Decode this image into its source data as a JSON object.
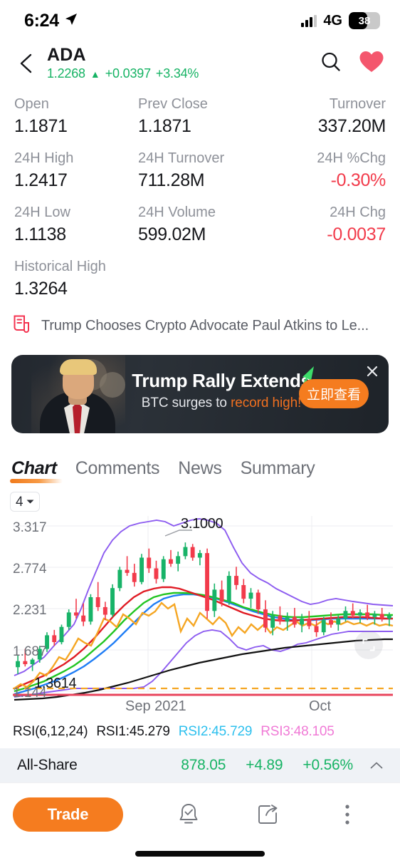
{
  "status_bar": {
    "time": "6:24",
    "location_icon": "location-arrow-icon",
    "signal_icon": "signal-bars-icon",
    "network": "4G",
    "battery_percent": "38"
  },
  "header": {
    "back_icon": "chevron-left-icon",
    "symbol": "ADA",
    "price": "1.2268",
    "direction_arrow": "▲",
    "change_abs": "+0.0397",
    "change_pct": "+3.34%",
    "up_color": "#16b364",
    "search_icon": "search-icon",
    "favorite_icon": "heart-icon",
    "favorite_color": "#f4566d"
  },
  "stats": {
    "rows": [
      [
        {
          "label": "Open",
          "value": "1.1871",
          "tone": "normal"
        },
        {
          "label": "Prev Close",
          "value": "1.1871",
          "tone": "normal"
        },
        {
          "label": "Turnover",
          "value": "337.20M",
          "tone": "normal"
        }
      ],
      [
        {
          "label": "24H High",
          "value": "1.2417",
          "tone": "normal"
        },
        {
          "label": "24H Turnover",
          "value": "711.28M",
          "tone": "normal"
        },
        {
          "label": "24H %Chg",
          "value": "-0.30%",
          "tone": "neg"
        }
      ],
      [
        {
          "label": "24H Low",
          "value": "1.1138",
          "tone": "normal"
        },
        {
          "label": "24H Volume",
          "value": "599.02M",
          "tone": "normal"
        },
        {
          "label": "24H Chg",
          "value": "-0.0037",
          "tone": "neg"
        }
      ],
      [
        {
          "label": "Historical High",
          "value": "1.3264",
          "tone": "normal"
        },
        {
          "label": "",
          "value": "",
          "tone": "normal"
        },
        {
          "label": "",
          "value": "",
          "tone": "normal"
        }
      ]
    ],
    "neg_color": "#f23b4b"
  },
  "news": {
    "icon": "news-document-icon",
    "icon_color": "#f4324f",
    "headline": "Trump Chooses Crypto Advocate Paul Atkins to Le..."
  },
  "banner": {
    "headline": "Trump Rally Extends",
    "subline_prefix": "BTC surges to ",
    "subline_highlight": "record high!",
    "cta_label": "立即查看",
    "cta_color": "#f57c1f",
    "close_icon": "close-icon",
    "trend_icon": "trending-up-arrow-icon",
    "trend_color": "#3ddc6a",
    "photo_alt": "trump-portrait-image"
  },
  "tabs": [
    {
      "label": "Chart",
      "active": true
    },
    {
      "label": "Comments",
      "active": false
    },
    {
      "label": "News",
      "active": false
    },
    {
      "label": "Summary",
      "active": false
    }
  ],
  "chart_toolbar": {
    "timeframe_value": "4",
    "timeframe_caret": "chevron-down-icon",
    "expand_icon": "expand-fullscreen-icon"
  },
  "chart_data": {
    "type": "line",
    "title": "",
    "xlabel": "",
    "ylabel": "",
    "grid": true,
    "legend_position": "none",
    "y_ticks": [
      "3.317",
      "2.774",
      "2.231",
      "1.687",
      "1.144"
    ],
    "ylim": [
      1.144,
      3.317
    ],
    "x_ticks": [
      "Sep 2021",
      "Oct"
    ],
    "x_tick_positions": [
      0.36,
      0.78
    ],
    "annotations": [
      {
        "label": "3.1000",
        "type": "high-marker",
        "x": 0.4,
        "y": 3.1
      },
      {
        "label": "1.3614",
        "type": "low-marker",
        "x": 0.16,
        "y": 1.3614
      }
    ],
    "series": [
      {
        "name": "candles",
        "color_up": "#18b368",
        "color_down": "#f23b4b"
      },
      {
        "name": "MA-orange",
        "color": "#f5a623"
      },
      {
        "name": "MA-red",
        "color": "#e01b24"
      },
      {
        "name": "MA-green",
        "color": "#22c521"
      },
      {
        "name": "MA-blue",
        "color": "#1f7df5"
      },
      {
        "name": "MA-black",
        "color": "#111111"
      },
      {
        "name": "Bollinger-upper",
        "color": "#8c5bf0"
      },
      {
        "name": "Bollinger-lower",
        "color": "#8c5bf0"
      },
      {
        "name": "support-dashed",
        "color": "#f5a623"
      },
      {
        "name": "baseline-red",
        "color": "#e8445c"
      }
    ],
    "ohlc": [
      {
        "o": 1.46,
        "h": 1.62,
        "l": 1.37,
        "c": 1.54
      },
      {
        "o": 1.54,
        "h": 1.7,
        "l": 1.47,
        "c": 1.5
      },
      {
        "o": 1.5,
        "h": 1.58,
        "l": 1.41,
        "c": 1.56
      },
      {
        "o": 1.56,
        "h": 1.74,
        "l": 1.52,
        "c": 1.7
      },
      {
        "o": 1.7,
        "h": 1.92,
        "l": 1.66,
        "c": 1.88
      },
      {
        "o": 1.88,
        "h": 1.95,
        "l": 1.74,
        "c": 1.79
      },
      {
        "o": 1.79,
        "h": 2.02,
        "l": 1.76,
        "c": 1.99
      },
      {
        "o": 1.99,
        "h": 2.22,
        "l": 1.95,
        "c": 2.18
      },
      {
        "o": 2.18,
        "h": 2.36,
        "l": 2.1,
        "c": 2.14
      },
      {
        "o": 2.14,
        "h": 2.3,
        "l": 2.0,
        "c": 2.06
      },
      {
        "o": 2.06,
        "h": 2.42,
        "l": 2.02,
        "c": 2.38
      },
      {
        "o": 2.38,
        "h": 2.58,
        "l": 2.2,
        "c": 2.25
      },
      {
        "o": 2.25,
        "h": 2.32,
        "l": 2.08,
        "c": 2.15
      },
      {
        "o": 2.15,
        "h": 2.55,
        "l": 2.12,
        "c": 2.5
      },
      {
        "o": 2.5,
        "h": 2.78,
        "l": 2.46,
        "c": 2.74
      },
      {
        "o": 2.74,
        "h": 2.92,
        "l": 2.66,
        "c": 2.7
      },
      {
        "o": 2.7,
        "h": 2.82,
        "l": 2.52,
        "c": 2.58
      },
      {
        "o": 2.58,
        "h": 2.95,
        "l": 2.55,
        "c": 2.9
      },
      {
        "o": 2.9,
        "h": 3.02,
        "l": 2.7,
        "c": 2.76
      },
      {
        "o": 2.76,
        "h": 2.86,
        "l": 2.56,
        "c": 2.62
      },
      {
        "o": 2.62,
        "h": 2.92,
        "l": 2.58,
        "c": 2.88
      },
      {
        "o": 2.88,
        "h": 3.0,
        "l": 2.78,
        "c": 2.82
      },
      {
        "o": 2.82,
        "h": 2.98,
        "l": 2.72,
        "c": 2.92
      },
      {
        "o": 2.92,
        "h": 3.1,
        "l": 2.88,
        "c": 3.04
      },
      {
        "o": 3.04,
        "h": 3.08,
        "l": 2.86,
        "c": 2.9
      },
      {
        "o": 2.9,
        "h": 3.0,
        "l": 2.8,
        "c": 2.96
      },
      {
        "o": 2.96,
        "h": 3.02,
        "l": 2.1,
        "c": 2.2
      },
      {
        "o": 2.2,
        "h": 2.56,
        "l": 2.12,
        "c": 2.48
      },
      {
        "o": 2.48,
        "h": 2.6,
        "l": 2.26,
        "c": 2.32
      },
      {
        "o": 2.32,
        "h": 2.72,
        "l": 2.28,
        "c": 2.66
      },
      {
        "o": 2.66,
        "h": 2.78,
        "l": 2.48,
        "c": 2.54
      },
      {
        "o": 2.54,
        "h": 2.62,
        "l": 2.3,
        "c": 2.36
      },
      {
        "o": 2.36,
        "h": 2.5,
        "l": 2.24,
        "c": 2.44
      },
      {
        "o": 2.44,
        "h": 2.48,
        "l": 2.16,
        "c": 2.22
      },
      {
        "o": 2.22,
        "h": 2.34,
        "l": 1.92,
        "c": 1.98
      },
      {
        "o": 1.98,
        "h": 2.2,
        "l": 1.88,
        "c": 2.14
      },
      {
        "o": 2.14,
        "h": 2.26,
        "l": 2.02,
        "c": 2.06
      },
      {
        "o": 2.06,
        "h": 2.18,
        "l": 1.94,
        "c": 2.12
      },
      {
        "o": 2.12,
        "h": 2.24,
        "l": 1.98,
        "c": 2.02
      },
      {
        "o": 2.02,
        "h": 2.16,
        "l": 1.92,
        "c": 2.1
      },
      {
        "o": 2.1,
        "h": 2.2,
        "l": 1.96,
        "c": 2.0
      },
      {
        "o": 2.0,
        "h": 2.08,
        "l": 1.86,
        "c": 1.92
      },
      {
        "o": 1.92,
        "h": 2.12,
        "l": 1.88,
        "c": 2.08
      },
      {
        "o": 2.08,
        "h": 2.18,
        "l": 1.98,
        "c": 2.02
      },
      {
        "o": 2.02,
        "h": 2.14,
        "l": 1.94,
        "c": 2.1
      },
      {
        "o": 2.1,
        "h": 2.26,
        "l": 2.06,
        "c": 2.2
      },
      {
        "o": 2.2,
        "h": 2.3,
        "l": 2.1,
        "c": 2.14
      },
      {
        "o": 2.14,
        "h": 2.22,
        "l": 2.04,
        "c": 2.18
      },
      {
        "o": 2.18,
        "h": 2.28,
        "l": 2.08,
        "c": 2.12
      },
      {
        "o": 2.12,
        "h": 2.2,
        "l": 2.02,
        "c": 2.16
      },
      {
        "o": 2.16,
        "h": 2.24,
        "l": 2.06,
        "c": 2.1
      },
      {
        "o": 2.1,
        "h": 2.18,
        "l": 2.0,
        "c": 2.14
      }
    ]
  },
  "rsi": {
    "title": "RSI(6,12,24)",
    "rsi1": "RSI1:45.279",
    "rsi2": "RSI2:45.729",
    "rsi3": "RSI3:48.105",
    "rsi2_color": "#2ec0ee",
    "rsi3_color": "#f07ad6"
  },
  "all_share": {
    "name": "All-Share",
    "value": "878.05",
    "change_abs": "+4.89",
    "change_pct": "+0.56%",
    "caret_icon": "chevron-up-icon",
    "color": "#16b364"
  },
  "bottom_bar": {
    "trade_label": "Trade",
    "trade_color": "#f57c1f",
    "alert_icon": "bell-alert-icon",
    "share_icon": "share-export-icon",
    "more_icon": "more-vertical-icon"
  }
}
